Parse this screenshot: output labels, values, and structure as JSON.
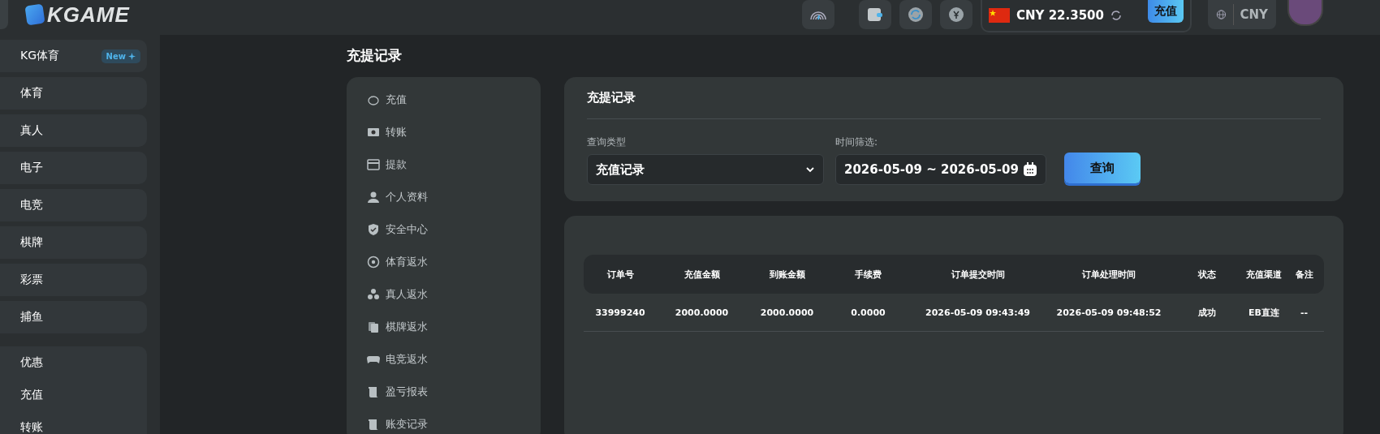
{
  "header": {
    "logo": "KGAME",
    "balance": {
      "currency_amount": "CNY 22.3500",
      "deposit_button": "充值"
    },
    "language_currency": "CNY"
  },
  "sidebar": {
    "groups": [
      {
        "items": [
          {
            "label": "KG体育",
            "badge": "New"
          }
        ]
      },
      {
        "items": [
          {
            "label": "体育"
          }
        ]
      },
      {
        "items": [
          {
            "label": "真人"
          }
        ]
      },
      {
        "items": [
          {
            "label": "电子"
          }
        ]
      },
      {
        "items": [
          {
            "label": "电竞"
          }
        ]
      },
      {
        "items": [
          {
            "label": "棋牌"
          }
        ]
      },
      {
        "items": [
          {
            "label": "彩票"
          }
        ]
      },
      {
        "items": [
          {
            "label": "捕鱼"
          }
        ]
      },
      {
        "items": [
          {
            "label": "优惠"
          },
          {
            "label": "充值"
          },
          {
            "label": "转账"
          }
        ]
      }
    ]
  },
  "page_title": "充提记录",
  "account_menu": [
    {
      "label": "充值"
    },
    {
      "label": "转账"
    },
    {
      "label": "提款"
    },
    {
      "label": "个人资料"
    },
    {
      "label": "安全中心"
    },
    {
      "label": "体育返水"
    },
    {
      "label": "真人返水"
    },
    {
      "label": "棋牌返水"
    },
    {
      "label": "电竞返水"
    },
    {
      "label": "盈亏报表"
    },
    {
      "label": "账变记录"
    }
  ],
  "filter_card": {
    "title": "充提记录",
    "type_label": "查询类型",
    "type_value": "充值记录",
    "date_label": "时间筛选:",
    "date_value": "2026-05-09 ~ 2026-05-09",
    "search_button": "查询"
  },
  "table": {
    "columns": [
      "订单号",
      "充值金额",
      "到账金额",
      "手续费",
      "订单提交时间",
      "订单处理时间",
      "状态",
      "充值渠道",
      "备注"
    ],
    "rows": [
      [
        "33999240",
        "2000.0000",
        "2000.0000",
        "0.0000",
        "2026-05-09 09:43:49",
        "2026-05-09 09:48:52",
        "成功",
        "EB直连",
        "--"
      ]
    ]
  }
}
